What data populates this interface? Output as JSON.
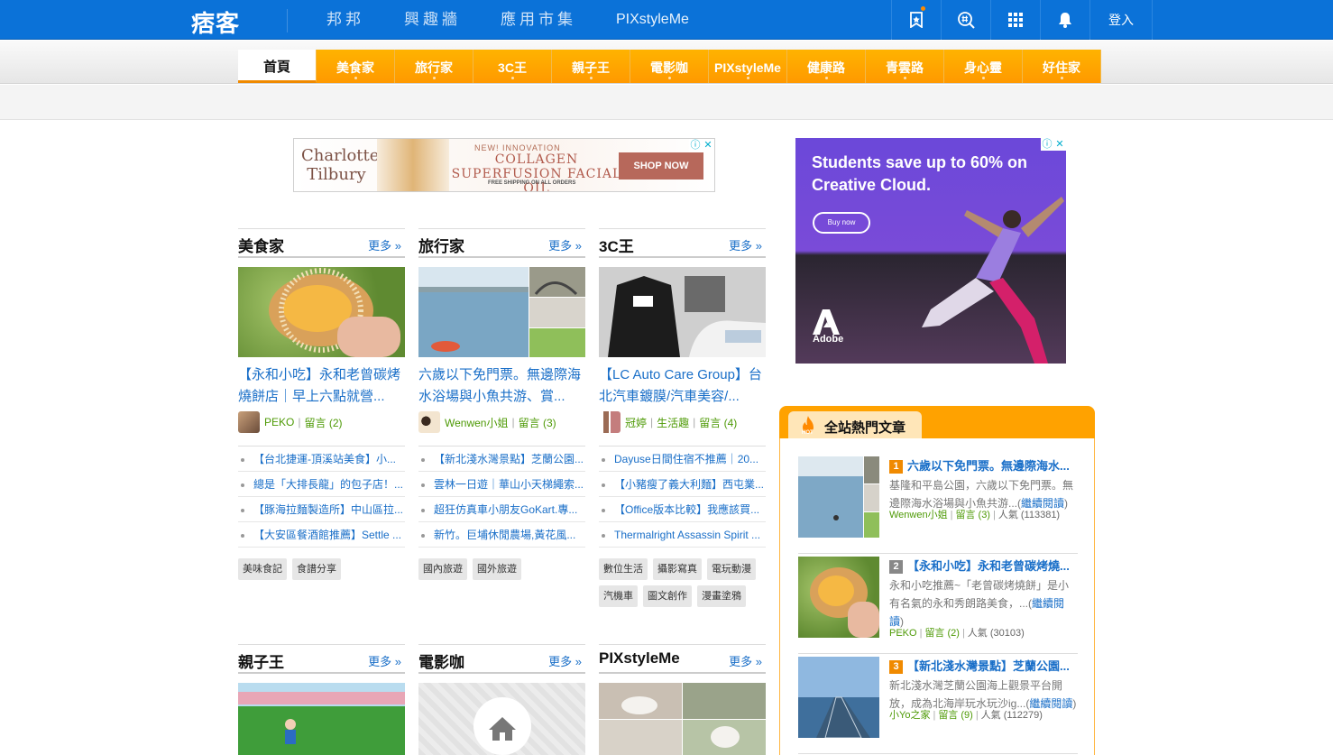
{
  "topbar": {
    "logo": "痞客邦",
    "nav": [
      "邦邦",
      "興趣牆",
      "應用市集",
      "PIXstyleMe"
    ],
    "login": "登入",
    "icons": [
      "bookmark-icon",
      "search-hash-icon",
      "apps-grid-icon",
      "bell-icon"
    ],
    "colors": {
      "bar": "#0b72d8",
      "accent": "#ff9900"
    }
  },
  "categories": [
    "首頁",
    "美食家",
    "旅行家",
    "3C王",
    "親子王",
    "電影咖",
    "PIXstyleMe",
    "健康路",
    "青雲路",
    "身心靈",
    "好住家"
  ],
  "ad_banner": {
    "brand": "Charlotte Tilbury",
    "tagline": "NEW! INNOVATION",
    "headline": "COLLAGEN SUPERFUSION FACIAL OIL",
    "note": "FREE SHIPPING ON ALL ORDERS",
    "cta": "SHOP NOW"
  },
  "ad_side": {
    "headline": "Students save up to 60% on Creative Cloud.",
    "cta": "Buy now",
    "brand": "Adobe"
  },
  "sections_row1": [
    {
      "title": "美食家",
      "more": "更多 »",
      "headline": "【永和小吃】永和老曾碳烤燒餅店｜早上六點就營...",
      "author": "PEKO",
      "comments": "留言 (2)",
      "extra": "",
      "list": [
        "【台北捷運-頂溪站美食】小...",
        "總是「大排長龍」的包子店！...",
        "【豚海拉麵製造所】中山區拉...",
        "【大安區餐酒館推薦】Settle ..."
      ],
      "tags": [
        "美味食記",
        "食譜分享"
      ]
    },
    {
      "title": "旅行家",
      "more": "更多 »",
      "headline": "六歲以下免門票。無邊際海水浴場與小魚共游、賞...",
      "author": "Wenwen小姐",
      "comments": "留言 (3)",
      "extra": "",
      "list": [
        "【新北淺水灣景點】芝蘭公園...",
        "雲林一日遊｜華山小天梯繩索...",
        "超狂仿真車小朋友GoKart.專...",
        "新竹。巨埔休閒農場,黃花風..."
      ],
      "tags": [
        "國內旅遊",
        "國外旅遊"
      ]
    },
    {
      "title": "3C王",
      "more": "更多 »",
      "headline": "【LC Auto Care Group】台北汽車鍍膜/汽車美容/...",
      "author": "冠婷",
      "comments": "留言 (4)",
      "extra": "生活趣",
      "list": [
        "Dayuse日間住宿不推薦｜20...",
        "【小豬瘦了義大利麵】西屯業...",
        "【Office版本比較】我應該買...",
        "Thermalright Assassin Spirit ..."
      ],
      "tags": [
        "數位生活",
        "攝影寫真",
        "電玩動漫",
        "汽機車",
        "圖文創作",
        "漫畫塗鴉"
      ]
    }
  ],
  "sections_row2": [
    {
      "title": "親子王",
      "more": "更多 »"
    },
    {
      "title": "電影咖",
      "more": "更多 »"
    },
    {
      "title": "PIXstyleMe",
      "more": "更多 »"
    }
  ],
  "hot": {
    "title": "全站熱門文章",
    "badge": "HOT",
    "items": [
      {
        "rank": "1",
        "title": "六歲以下免門票。無邊際海水...",
        "desc": "基隆和平島公園，六歲以下免門票。無邊際海水浴場與小魚共游...(",
        "read": "繼續閱讀",
        "close": ")",
        "author": "Wenwen小姐",
        "comments": "留言 (3)",
        "pop": "人氣 (113381)",
        "color": "#f08a00"
      },
      {
        "rank": "2",
        "title": "【永和小吃】永和老曾碳烤燒...",
        "desc": "永和小吃推薦~「老曾碳烤燒餅」是小有名氣的永和秀朗路美食，...(",
        "read": "繼續閱讀",
        "close": ")",
        "author": "PEKO",
        "comments": "留言 (2)",
        "pop": "人氣 (30103)",
        "color": "#888888"
      },
      {
        "rank": "3",
        "title": "【新北淺水灣景點】芝蘭公園...",
        "desc": "新北淺水灣芝蘭公園海上觀景平台開放，成為北海岸玩水玩沙ig...(",
        "read": "繼續閱讀",
        "close": ")",
        "author": "小Yo之家",
        "comments": "留言 (9)",
        "pop": "人氣 (112279)",
        "color": "#f08a00"
      }
    ]
  }
}
